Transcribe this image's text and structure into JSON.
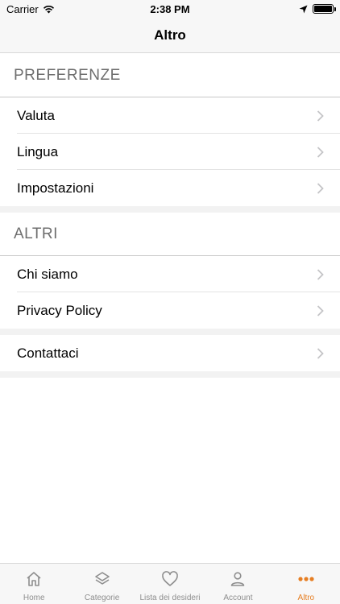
{
  "status_bar": {
    "carrier": "Carrier",
    "time": "2:38 PM"
  },
  "nav": {
    "title": "Altro"
  },
  "sections": {
    "preferenze": {
      "header": "PREFERENZE",
      "items": [
        {
          "label": "Valuta"
        },
        {
          "label": "Lingua"
        },
        {
          "label": "Impostazioni"
        }
      ]
    },
    "altri": {
      "header": "ALTRI",
      "items": [
        {
          "label": "Chi siamo"
        },
        {
          "label": "Privacy Policy"
        }
      ]
    },
    "contatti": {
      "items": [
        {
          "label": "Contattaci"
        }
      ]
    }
  },
  "tab_bar": {
    "items": [
      {
        "label": "Home",
        "icon": "home-icon"
      },
      {
        "label": "Categorie",
        "icon": "layers-icon"
      },
      {
        "label": "Lista dei desideri",
        "icon": "heart-icon"
      },
      {
        "label": "Account",
        "icon": "person-icon"
      },
      {
        "label": "Altro",
        "icon": "more-dots-icon"
      }
    ],
    "active": "Altro",
    "active_color": "#e67e22",
    "inactive_color": "#8e8e8e"
  }
}
